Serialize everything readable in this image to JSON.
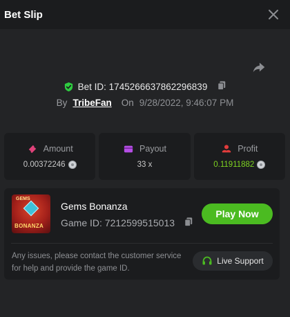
{
  "header": {
    "title": "Bet Slip"
  },
  "bet": {
    "id_text": "Bet ID: 1745266637862296839",
    "by_label": "By",
    "user": "TribeFan",
    "on_label": "On",
    "datetime": "9/28/2022, 9:46:07 PM"
  },
  "stats": {
    "amount": {
      "label": "Amount",
      "value": "0.00372246"
    },
    "payout": {
      "label": "Payout",
      "value": "33 x"
    },
    "profit": {
      "label": "Profit",
      "value": "0.11911882"
    }
  },
  "game": {
    "name": "Gems Bonanza",
    "id_text": "Game ID: 7212599515013",
    "play_label": "Play Now",
    "thumb_top": "GEMS",
    "thumb_bottom": "BONANZA"
  },
  "support": {
    "note": "Any issues, please contact the customer service for help and provide the game ID.",
    "button_label": "Live Support"
  },
  "colors": {
    "accent_green": "#4bbb21",
    "profit_green": "#7ed321",
    "amount_pink": "#e0427a",
    "payout_purple": "#b54ee5",
    "profit_red": "#e03b3b",
    "shield_green": "#2ecc40"
  },
  "icons": {
    "close": "close-icon",
    "share": "share-icon",
    "verified": "shield-check-icon",
    "copy": "copy-icon",
    "amount": "ticket-icon",
    "payout": "wallet-icon",
    "profit": "profit-icon",
    "coin": "coin-icon",
    "support": "headset-icon"
  }
}
